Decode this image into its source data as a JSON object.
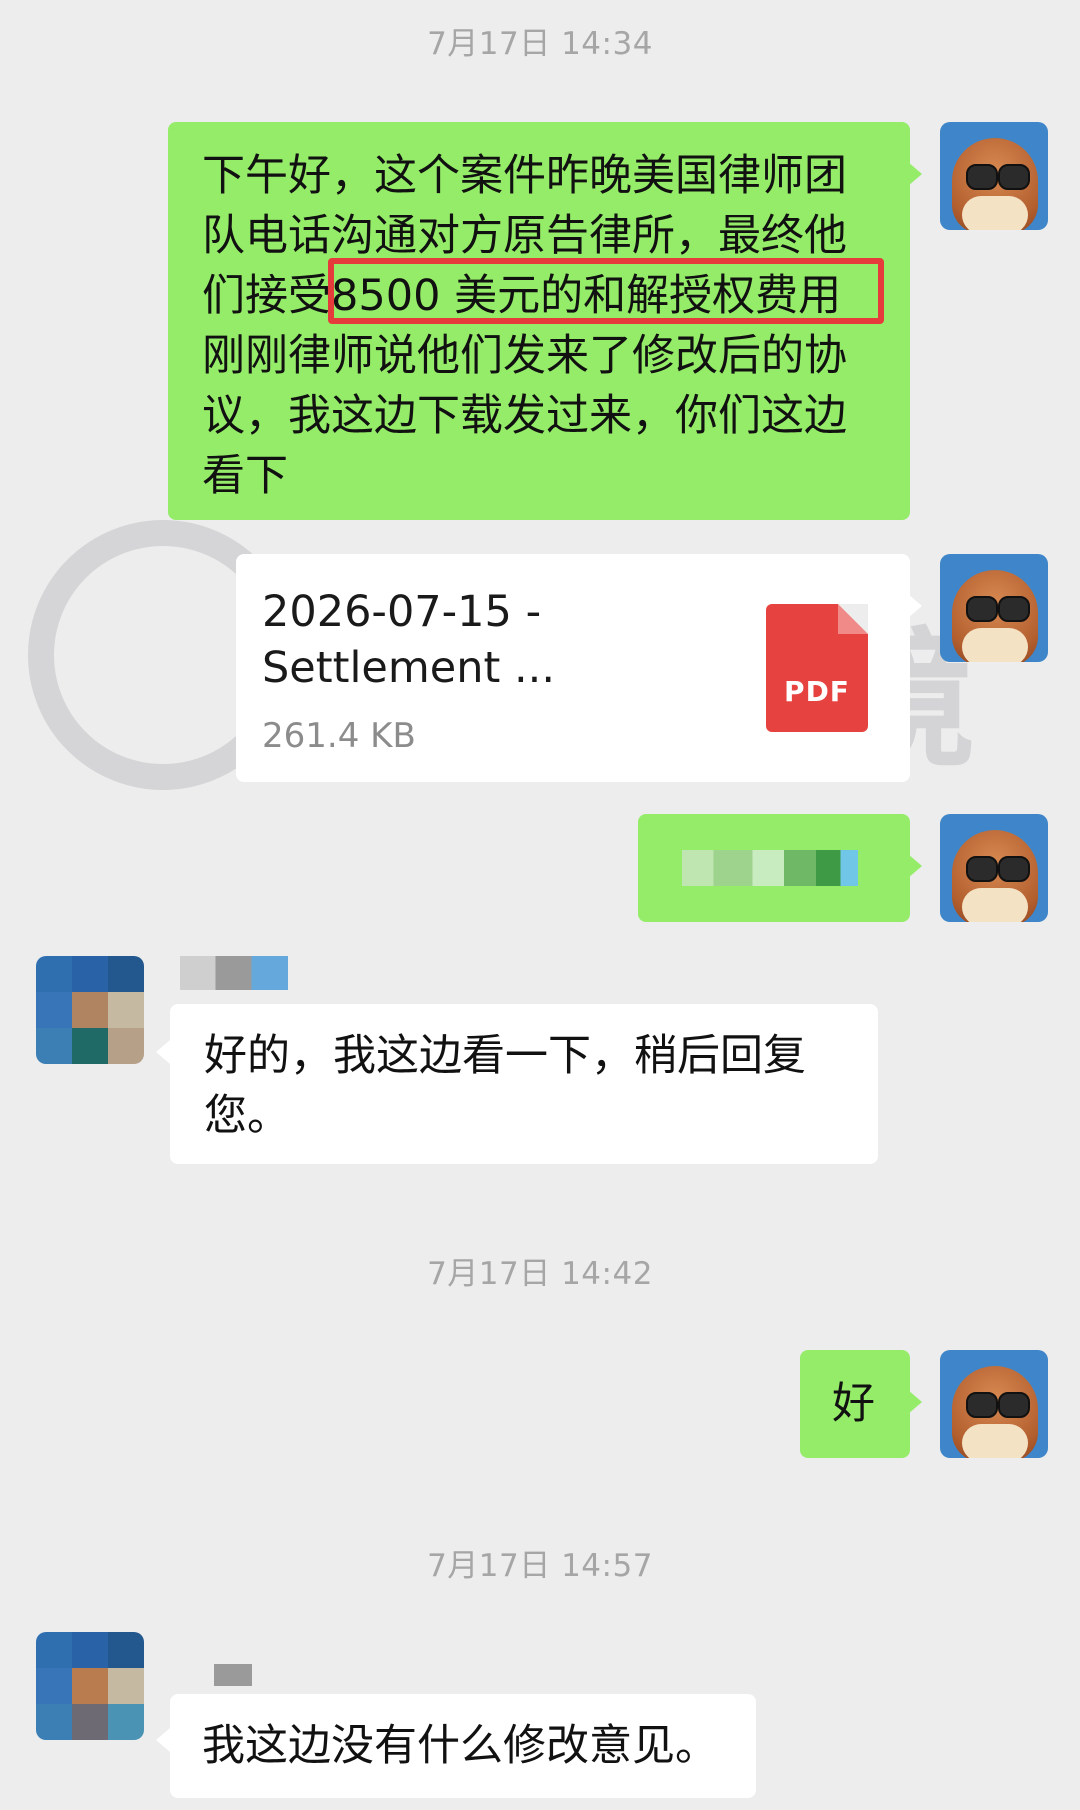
{
  "timestamps": [
    "7月17日 14:34",
    "7月17日 14:42",
    "7月17日 14:57"
  ],
  "messages": {
    "m1_lines": [
      "下午好，这个案件昨晚美国律师团",
      "队电话沟通对方原告律所，最终他",
      "们接受8500 美元的和解授权费用",
      "刚刚律师说他们发来了修改后的协",
      "议，我这边下载发过来，你们这边",
      "看下"
    ],
    "m1_highlight": "8500 美元的和解授权费用",
    "file": {
      "title_line1": "2026-07-15 -",
      "title_line2": "Settlement ...",
      "size": "261.4 KB",
      "icon_label": "PDF"
    },
    "m4_lines": [
      "好的，我这边看一下，稍后回复",
      "您。"
    ],
    "m5": "好",
    "m6": "我这边没有什么修改意见。"
  },
  "watermark": "墨婷跨境",
  "icons": {
    "self_avatar": "bear-with-sunglasses-avatar",
    "other_avatar": "pixelated-avatar",
    "file_icon": "pdf-file-icon"
  },
  "colors": {
    "background": "#ededed",
    "sent_bubble": "#95ec69",
    "received_bubble": "#ffffff",
    "highlight_box": "#e63b3b",
    "pdf_red": "#e64340",
    "timestamp_text": "#a6a6a6"
  }
}
